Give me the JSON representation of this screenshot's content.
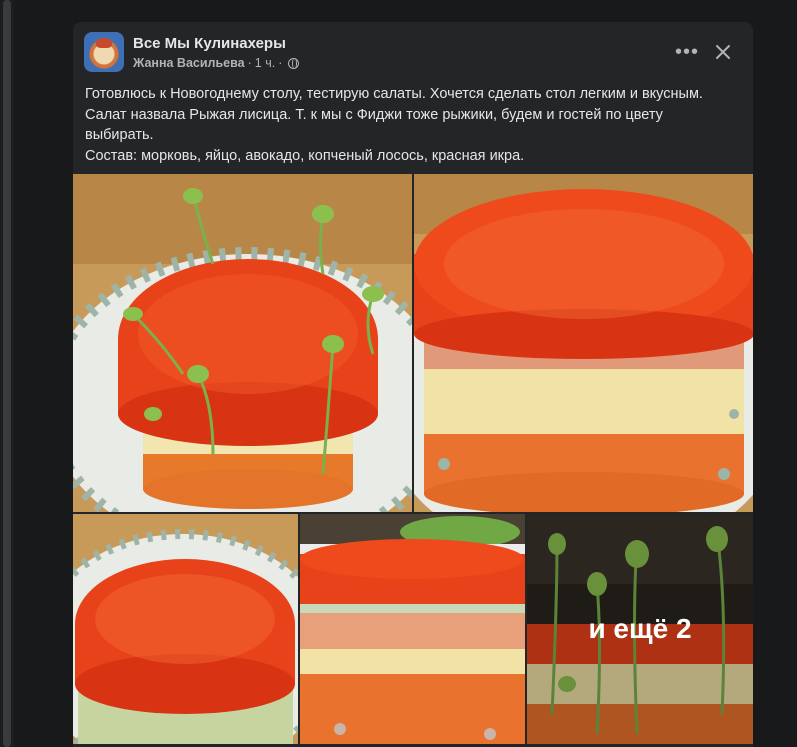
{
  "post": {
    "group_name": "Все Мы Кулинахеры",
    "author": "Жанна Васильева",
    "time": "1 ч.",
    "text_lines": [
      "Готовлюсь к Новогоднему столу, тестирую салаты. Хочется сделать стол легким и вкусным.",
      "Салат назвала Рыжая лисица. Т. к мы с Фиджи тоже рыжики, будем и гостей по цвету выбирать.",
      "Состав: морковь, яйцо, авокадо, копченый лосось, красная икра."
    ],
    "more_photos_label": "и ещё 2"
  },
  "icons": {
    "more": "more-options-icon",
    "close": "close-icon",
    "privacy": "globe-icon"
  },
  "colors": {
    "page_bg": "#18191a",
    "card_bg": "#242526",
    "text_primary": "#e4e6eb",
    "text_secondary": "#b0b3b8",
    "caviar": "#e8421a",
    "carrot": "#e8722e"
  }
}
